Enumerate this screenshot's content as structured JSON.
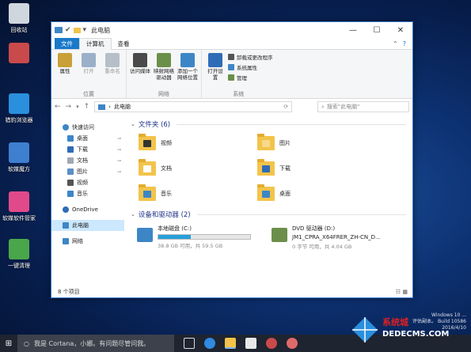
{
  "desktop": {
    "icons": [
      {
        "label": "回收站",
        "color": "#d0d6de",
        "icon": "recycle-bin-icon"
      },
      {
        "label": "",
        "color": "#c94a4a",
        "icon": "blurred-app-icon"
      },
      {
        "label": "猎豹浏览器",
        "color": "#2a8fdd",
        "icon": "browser-icon"
      },
      {
        "label": "软媒魔方",
        "color": "#3f7fd0",
        "icon": "cube-icon"
      },
      {
        "label": "软媒软件管家",
        "color": "#e04a8a",
        "icon": "software-manager-icon"
      },
      {
        "label": "一键清理",
        "color": "#4aa64a",
        "icon": "cleaner-icon"
      }
    ]
  },
  "window": {
    "title": "此电脑",
    "tabs": {
      "file": "文件",
      "computer": "计算机",
      "view": "查看"
    },
    "ribbon": {
      "location": {
        "name": "位置",
        "cmds": [
          {
            "label": "属性",
            "color": "#c9a038",
            "disabled": false
          },
          {
            "label": "打开",
            "color": "#9ab0c8",
            "disabled": true
          },
          {
            "label": "重命名",
            "color": "#b7bec7",
            "disabled": true
          }
        ]
      },
      "network": {
        "name": "网络",
        "cmds": [
          {
            "label": "访问媒体",
            "color": "#4a4a4a"
          },
          {
            "label": "映射网络驱动器",
            "color": "#6b8f4a"
          },
          {
            "label": "添加一个网络位置",
            "color": "#3d86c6"
          }
        ]
      },
      "system": {
        "name": "系统",
        "open_settings": "打开设置",
        "items": [
          "卸载或更改程序",
          "系统属性",
          "管理"
        ]
      }
    },
    "address": {
      "path": "此电脑"
    },
    "search": {
      "placeholder": "搜索\"此电脑\""
    },
    "nav": {
      "quick_access": "快速访问",
      "items": [
        {
          "label": "桌面",
          "pinned": true,
          "color": "#3d86c6"
        },
        {
          "label": "下载",
          "pinned": true,
          "color": "#2f6cb8"
        },
        {
          "label": "文档",
          "pinned": true,
          "color": "#a0a8b2"
        },
        {
          "label": "图片",
          "pinned": true,
          "color": "#5a8fc7"
        },
        {
          "label": "视频",
          "pinned": false,
          "color": "#555"
        },
        {
          "label": "音乐",
          "pinned": false,
          "color": "#3d86c6"
        }
      ],
      "onedrive": "OneDrive",
      "this_pc": "此电脑",
      "network": "网络"
    },
    "folders_section": {
      "title": "文件夹 (6)",
      "folders": [
        {
          "label": "视频",
          "overlay": "#333"
        },
        {
          "label": "图片",
          "overlay": "#f8d88a"
        },
        {
          "label": "文档",
          "overlay": "#fff"
        },
        {
          "label": "下载",
          "overlay": "#2f6cb8"
        },
        {
          "label": "音乐",
          "overlay": "#3d86c6"
        },
        {
          "label": "桌面",
          "overlay": "#3d86c6"
        }
      ]
    },
    "drives_section": {
      "title": "设备和驱动器 (2)",
      "drives": [
        {
          "name": "本地磁盘 (C:)",
          "free": "38.8 GB 可用，共 59.5 GB",
          "used_fraction": 0.35,
          "color": "#3d86c6",
          "show_bar": true
        },
        {
          "name": "DVD 驱动器 (D:)",
          "subname": "JM1_CPRA_X64FRER_ZH-CN_D...",
          "free": "0 字节 可用，共 4.04 GB",
          "used_fraction": 1.0,
          "color": "#6b8f4a",
          "show_bar": false
        }
      ]
    },
    "status": "8 个项目"
  },
  "taskbar": {
    "search_placeholder": "我是 Cortana，小娜。有问题尽管问我。"
  },
  "watermark": {
    "line1": "Windows 10 ... ",
    "line2": "评估副本。 Build 10586",
    "line3": "2016/4/10"
  },
  "logo": {
    "brand": "系统城",
    "url": "DEDECMS.COM"
  }
}
